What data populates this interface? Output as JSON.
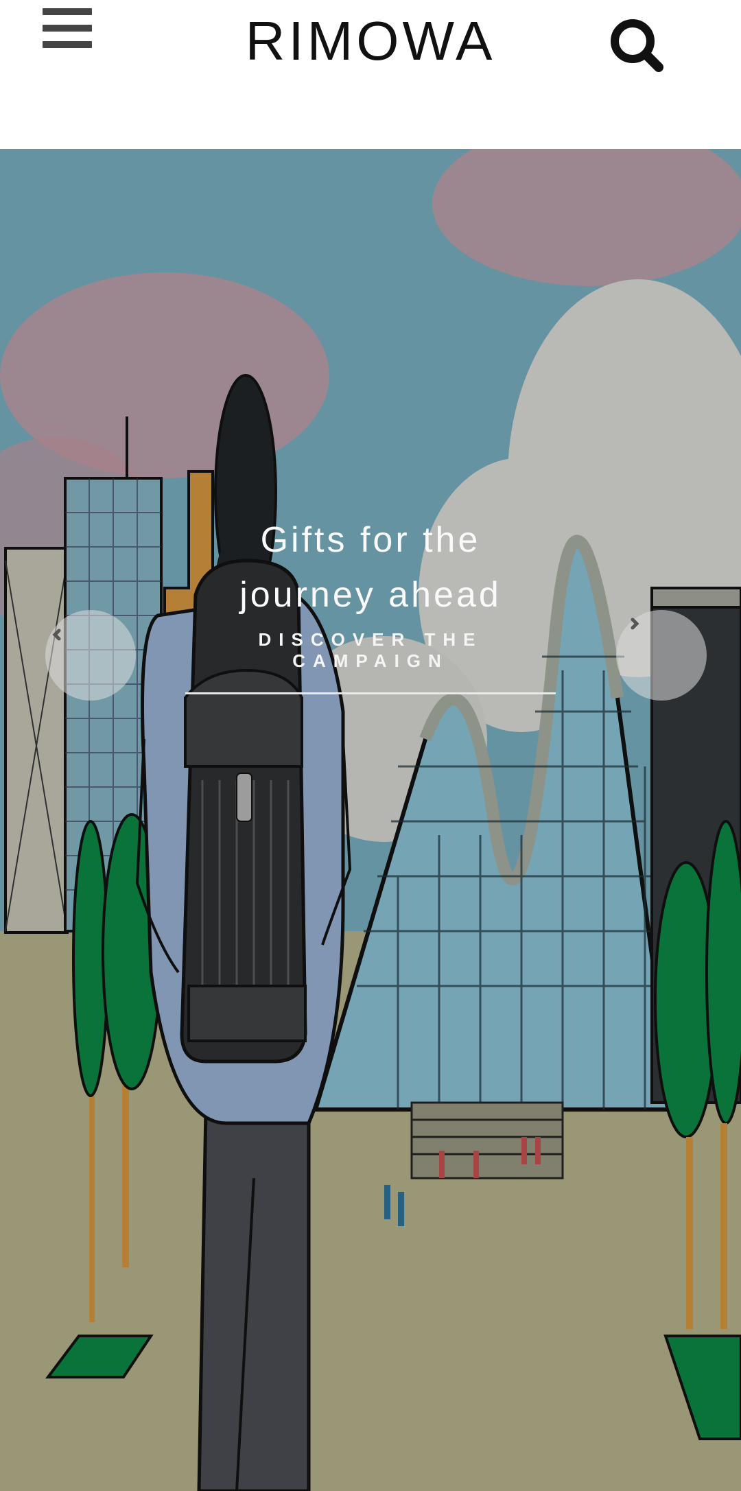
{
  "header": {
    "logo": "RIMOWA",
    "menu_icon": "hamburger-menu-icon",
    "search_icon": "search-icon"
  },
  "hero": {
    "title_line1": "Gifts for the",
    "title_line2": "journey ahead",
    "cta_label": "DISCOVER THE CAMPAIGN",
    "prev_icon": "chevron-left-icon",
    "next_icon": "chevron-right-icon"
  },
  "colors": {
    "sky": "#6fa2b2",
    "cloud_pink": "#c98f97",
    "ground": "#a9a583",
    "tree_green": "#0b7d3f",
    "glass": "#7bb0c1",
    "text_white": "#ffffff"
  }
}
